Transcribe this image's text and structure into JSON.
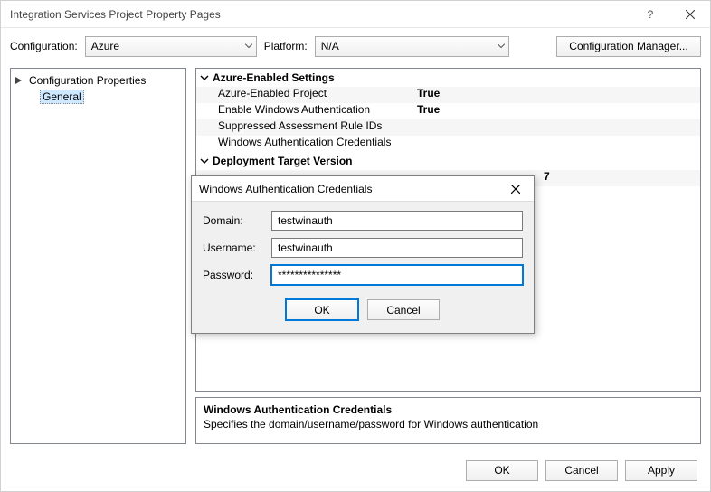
{
  "window": {
    "title": "Integration Services Project Property Pages",
    "help_char": "?",
    "close_char": "×"
  },
  "cfgbar": {
    "configuration_label": "Configuration:",
    "configuration_value": "Azure",
    "platform_label": "Platform:",
    "platform_value": "N/A",
    "manager_button": "Configuration Manager..."
  },
  "tree": {
    "root": "Configuration Properties",
    "child": "General"
  },
  "grid": {
    "section1": "Azure-Enabled Settings",
    "rows1": [
      {
        "k": "Azure-Enabled Project",
        "v": "True",
        "bold": true
      },
      {
        "k": "Enable Windows Authentication",
        "v": "True",
        "bold": true
      },
      {
        "k": "Suppressed Assessment Rule IDs",
        "v": "",
        "bold": false
      },
      {
        "k": "Windows Authentication Credentials",
        "v": "",
        "bold": false
      }
    ],
    "section2": "Deployment Target Version",
    "peek_value": "7"
  },
  "modal": {
    "title": "Windows Authentication Credentials",
    "domain_label": "Domain:",
    "domain_value": "testwinauth",
    "username_label": "Username:",
    "username_value": "testwinauth",
    "password_label": "Password:",
    "password_value": "***************",
    "ok": "OK",
    "cancel": "Cancel"
  },
  "description": {
    "title": "Windows Authentication Credentials",
    "text": "Specifies the domain/username/password for Windows authentication"
  },
  "footer": {
    "ok": "OK",
    "cancel": "Cancel",
    "apply": "Apply"
  }
}
